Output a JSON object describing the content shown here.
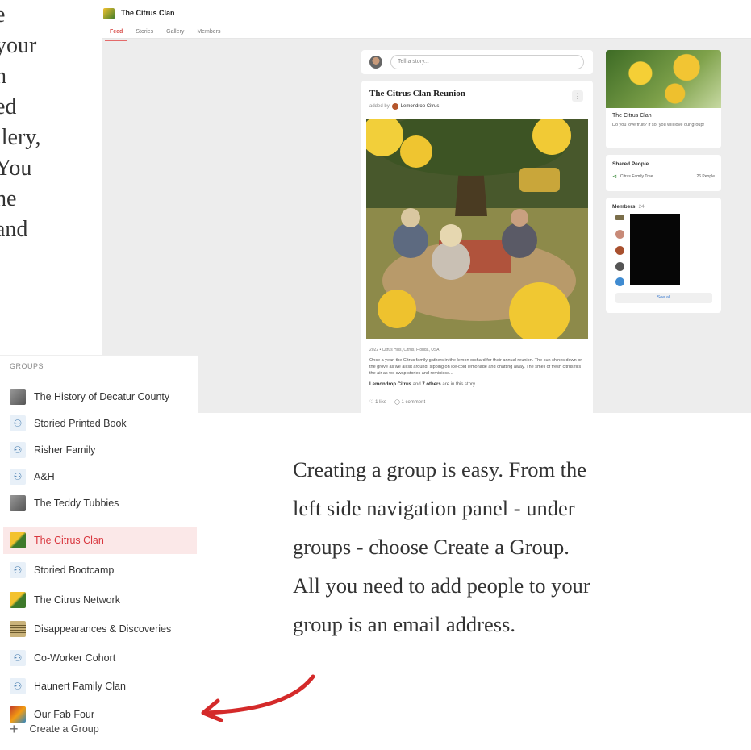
{
  "intro": {
    "lines": [
      "e",
      "your",
      "h",
      "ed",
      "llery,",
      "You",
      "he",
      "and"
    ]
  },
  "group_page": {
    "title": "The Citrus Clan",
    "tabs": [
      "Feed",
      "Stories",
      "Gallery",
      "Members"
    ],
    "active_tab": "Feed",
    "story_placeholder": "Tell a story...",
    "post": {
      "title": "The Citrus Clan Reunion",
      "added_by_prefix": "added by",
      "added_by_name": "Lemondrop Citrus",
      "meta": "2022 • Citrus Hills, Citrus, Florida, USA",
      "text": "Once a year, the Citrus family gathers in the lemon orchard for their annual reunion. The sun shines down on the grove as we all sit around, sipping on ice-cold lemonade and chatting away. The smell of fresh citrus fills the air as we swap stories and reminisce...",
      "people_name": "Lemondrop Citrus",
      "people_mid": "and",
      "people_others": "7 others",
      "people_suffix": "are in this story",
      "likes": "1 like",
      "comments": "1 comment"
    },
    "about_card": {
      "title": "The Citrus Clan",
      "description": "Do you love fruit? If so, you will love our group!"
    },
    "shared_people": {
      "heading": "Shared People",
      "tree_name": "Citrus Family Tree",
      "count": "26 People"
    },
    "members": {
      "heading": "Members",
      "count": "24",
      "see_all": "See all"
    }
  },
  "sidebar": {
    "header": "GROUPS",
    "items": [
      {
        "label": "The History of Decatur County",
        "icon": "photo-icon"
      },
      {
        "label": "Storied Printed Book",
        "icon": "people-icon"
      },
      {
        "label": "Risher Family",
        "icon": "people-icon"
      },
      {
        "label": "A&H",
        "icon": "people-icon"
      },
      {
        "label": "The Teddy Tubbies",
        "icon": "photo-icon"
      },
      {
        "label": "The Citrus Clan",
        "icon": "citrus-icon",
        "active": true
      },
      {
        "label": "Storied Bootcamp",
        "icon": "people-icon"
      },
      {
        "label": "The Citrus Network",
        "icon": "citrus-icon"
      },
      {
        "label": "Disappearances & Discoveries",
        "icon": "newspaper-icon"
      },
      {
        "label": "Co-Worker Cohort",
        "icon": "people-icon"
      },
      {
        "label": "Haunert Family Clan",
        "icon": "people-icon"
      },
      {
        "label": "Our Fab Four",
        "icon": "photo-icon"
      }
    ],
    "create_label": "Create a Group"
  },
  "caption": {
    "lines": [
      "Creating a group is easy. From the",
      "left side navigation panel - under",
      "groups - choose Create a Group.",
      "All you need to add people to your",
      "group is an email address."
    ]
  },
  "colors": {
    "accent": "#d9363e",
    "arrow": "#d42a2a",
    "active_bg": "#fbe8e8"
  }
}
